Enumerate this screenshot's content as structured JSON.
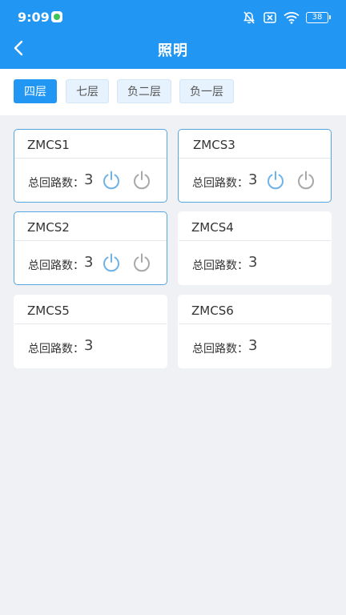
{
  "status_bar": {
    "time": "9:09",
    "battery": "38",
    "icons": [
      "app-notification-icon",
      "mute-icon",
      "no-sim-icon",
      "wifi-icon",
      "battery-icon"
    ]
  },
  "header": {
    "title": "照明",
    "back_icon": "back-arrow-icon"
  },
  "floor_tabs": [
    {
      "label": "四层",
      "active": true
    },
    {
      "label": "七层",
      "active": false
    },
    {
      "label": "负二层",
      "active": false
    },
    {
      "label": "负一层",
      "active": false
    }
  ],
  "devices": [
    {
      "name": "ZMCS1",
      "label": "总回路数：",
      "count": "3",
      "has_controls": true,
      "selected": true
    },
    {
      "name": "ZMCS3",
      "label": "总回路数：",
      "count": "3",
      "has_controls": true,
      "selected": true
    },
    {
      "name": "ZMCS2",
      "label": "总回路数：",
      "count": "3",
      "has_controls": true,
      "selected": true
    },
    {
      "name": "ZMCS4",
      "label": "总回路数：",
      "count": "3",
      "has_controls": false,
      "selected": false
    },
    {
      "name": "ZMCS5",
      "label": "总回路数：",
      "count": "3",
      "has_controls": false,
      "selected": false
    },
    {
      "name": "ZMCS6",
      "label": "总回路数：",
      "count": "3",
      "has_controls": false,
      "selected": false
    }
  ],
  "colors": {
    "primary": "#2196f3",
    "power_on": "#6fb3e6",
    "power_off": "#a8a8a8",
    "background": "#eff1f5"
  }
}
